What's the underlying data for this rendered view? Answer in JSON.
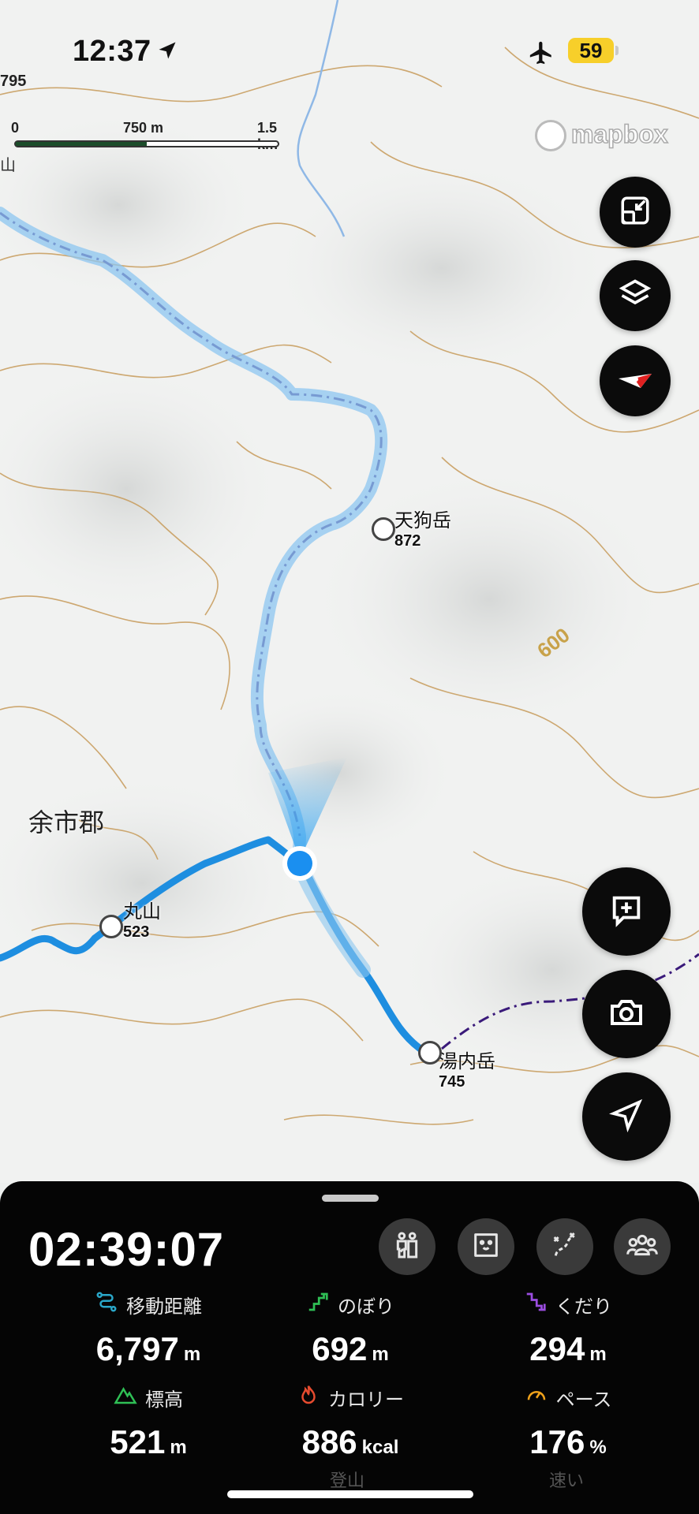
{
  "status_bar": {
    "time": "12:37",
    "battery": "59"
  },
  "map": {
    "edge_label_top": "795",
    "edge_label_yama": "山",
    "scale": {
      "zero": "0",
      "mid": "750 m",
      "end": "1.5 km"
    },
    "attribution": "mapbox",
    "region_label": "余市郡",
    "contour_label": "600",
    "peaks": [
      {
        "name": "天狗岳",
        "elevation": "872"
      },
      {
        "name": "丸山",
        "elevation": "523"
      },
      {
        "name": "湯内岳",
        "elevation": "745"
      }
    ]
  },
  "map_controls": [
    {
      "icon": "fit-screen-icon"
    },
    {
      "icon": "layers-icon"
    },
    {
      "icon": "compass-icon"
    },
    {
      "icon": "add-memo-icon"
    },
    {
      "icon": "camera-icon"
    },
    {
      "icon": "location-arrow-icon"
    }
  ],
  "panel": {
    "timer": "02:39:07",
    "actions": [
      {
        "icon": "companion-icon"
      },
      {
        "icon": "bear-icon"
      },
      {
        "icon": "route-icon"
      },
      {
        "icon": "group-icon"
      }
    ],
    "stats": [
      {
        "label": "移動距離",
        "value": "6,797",
        "unit": "m",
        "color": "#2aa7c9"
      },
      {
        "label": "のぼり",
        "value": "692",
        "unit": "m",
        "color": "#2fbf55"
      },
      {
        "label": "くだり",
        "value": "294",
        "unit": "m",
        "color": "#9b4de0"
      },
      {
        "label": "標高",
        "value": "521",
        "unit": "m",
        "color": "#2fbf55"
      },
      {
        "label": "カロリー",
        "value": "886",
        "unit": "kcal",
        "color": "#e64b2f"
      },
      {
        "label": "ペース",
        "value": "176",
        "unit": "%",
        "color": "#f0a21b"
      }
    ],
    "activity_type": "登山",
    "pace_status": "速い"
  },
  "colors": {
    "track": "#1e8ee0",
    "planned_route": "#3a1a7a",
    "contour": "#c79b5a"
  }
}
